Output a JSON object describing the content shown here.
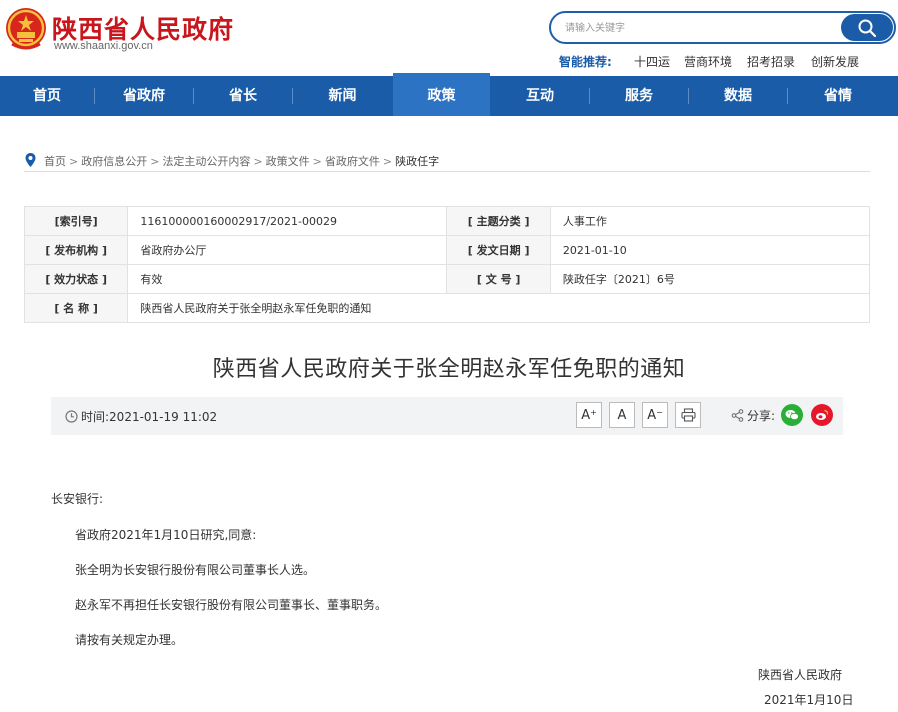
{
  "header": {
    "site_title": "陕西省人民政府",
    "site_url": "www.shaanxi.gov.cn",
    "search_placeholder": "请输入关键字",
    "hot_label": "智能推荐:",
    "hot_items": [
      "十四运",
      "营商环境",
      "招考招录",
      "创新发展"
    ]
  },
  "nav": {
    "items": [
      "首页",
      "省政府",
      "省长",
      "新闻",
      "政策",
      "互动",
      "服务",
      "数据",
      "省情"
    ],
    "active_index": 4
  },
  "breadcrumb": [
    "首页",
    "政府信息公开",
    "法定主动公开内容",
    "政策文件",
    "省政府文件",
    "陕政任字"
  ],
  "info": {
    "index_label": "[索引号]",
    "index_value": "116100000160002917/2021-00029",
    "topic_label": "[ 主题分类 ]",
    "topic_value": "人事工作",
    "issuer_label": "[ 发布机构 ]",
    "issuer_value": "省政府办公厅",
    "date_label": "[ 发文日期 ]",
    "date_value": "2021-01-10",
    "status_label": "[ 效力状态 ]",
    "status_value": "有效",
    "docno_label": "[ 文 号 ]",
    "docno_value": "陕政任字〔2021〕6号",
    "name_label": "[ 名 称 ]",
    "name_value": "陕西省人民政府关于张全明赵永军任免职的通知"
  },
  "article": {
    "title": "陕西省人民政府关于张全明赵永军任免职的通知",
    "time_label": "时间:",
    "time_value": "2021-01-19 11:02",
    "font_buttons": [
      "A",
      "A",
      "A"
    ],
    "share_label": "分享:",
    "salutation": "长安银行:",
    "paragraphs": [
      "省政府2021年1月10日研究,同意:",
      "张全明为长安银行股份有限公司董事长人选。",
      "赵永军不再担任长安银行股份有限公司董事长、董事职务。",
      "请按有关规定办理。"
    ],
    "signature": "陕西省人民政府",
    "sign_date": "2021年1月10日"
  },
  "colors": {
    "brand_red": "#c8161d",
    "nav_blue": "#1a5ca8",
    "nav_active": "#2d73c4",
    "wechat_green": "#2aae37",
    "weibo_red": "#e6162d"
  }
}
